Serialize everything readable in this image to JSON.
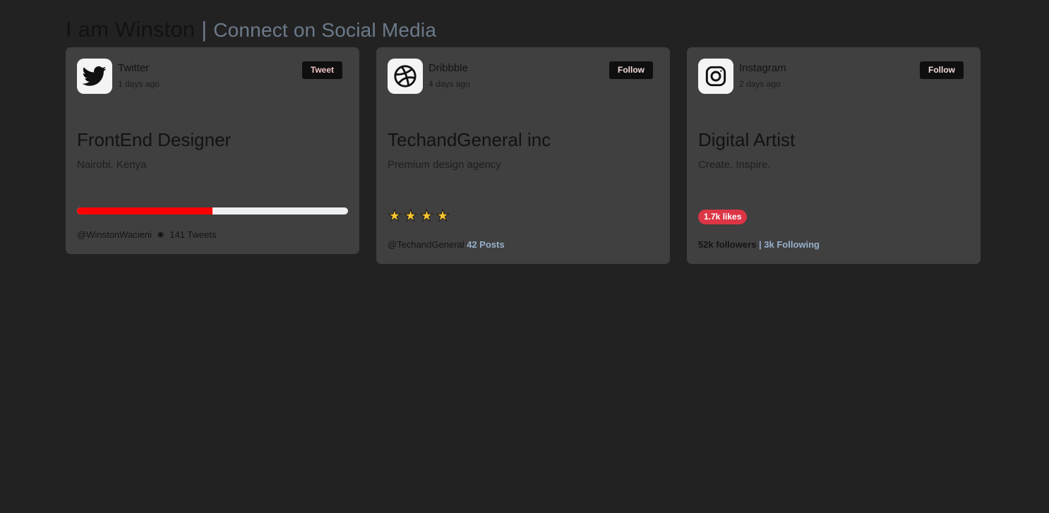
{
  "header": {
    "name": "I am Winston",
    "separator": "|",
    "subtitle": "Connect on Social Media"
  },
  "cards": [
    {
      "platform": "Twitter",
      "ago": "1 days ago",
      "button": "Tweet",
      "icon": "twitter-bird-icon",
      "role": "FrontEnd Designer",
      "description": "Nairobi, Kenya",
      "progress": 0.5,
      "progress_color": "#ff0000",
      "handle": "@WinstonWacieni",
      "stat": "141 Tweets"
    },
    {
      "platform": "Dribbble",
      "ago": "4 days ago",
      "button": "Follow",
      "icon": "dribbble-ball-icon",
      "role": "TechandGeneral inc",
      "description": "Premium design agency",
      "rating": 4,
      "handle": "@TechandGeneral",
      "stat": "42 Posts"
    },
    {
      "platform": "Instagram",
      "ago": "2 days ago",
      "button": "Follow",
      "icon": "instagram-camera-icon",
      "role": "Digital Artist",
      "description": "Create. Inspire.",
      "likes": "1.7k likes",
      "followers": "52k followers",
      "separator": "|",
      "following": "3k Following"
    }
  ],
  "colors": {
    "background": "#222222",
    "card": "#404040",
    "accent": "#98b0cc",
    "likes_badge": "#dc3545",
    "star": "#f7c32e"
  }
}
